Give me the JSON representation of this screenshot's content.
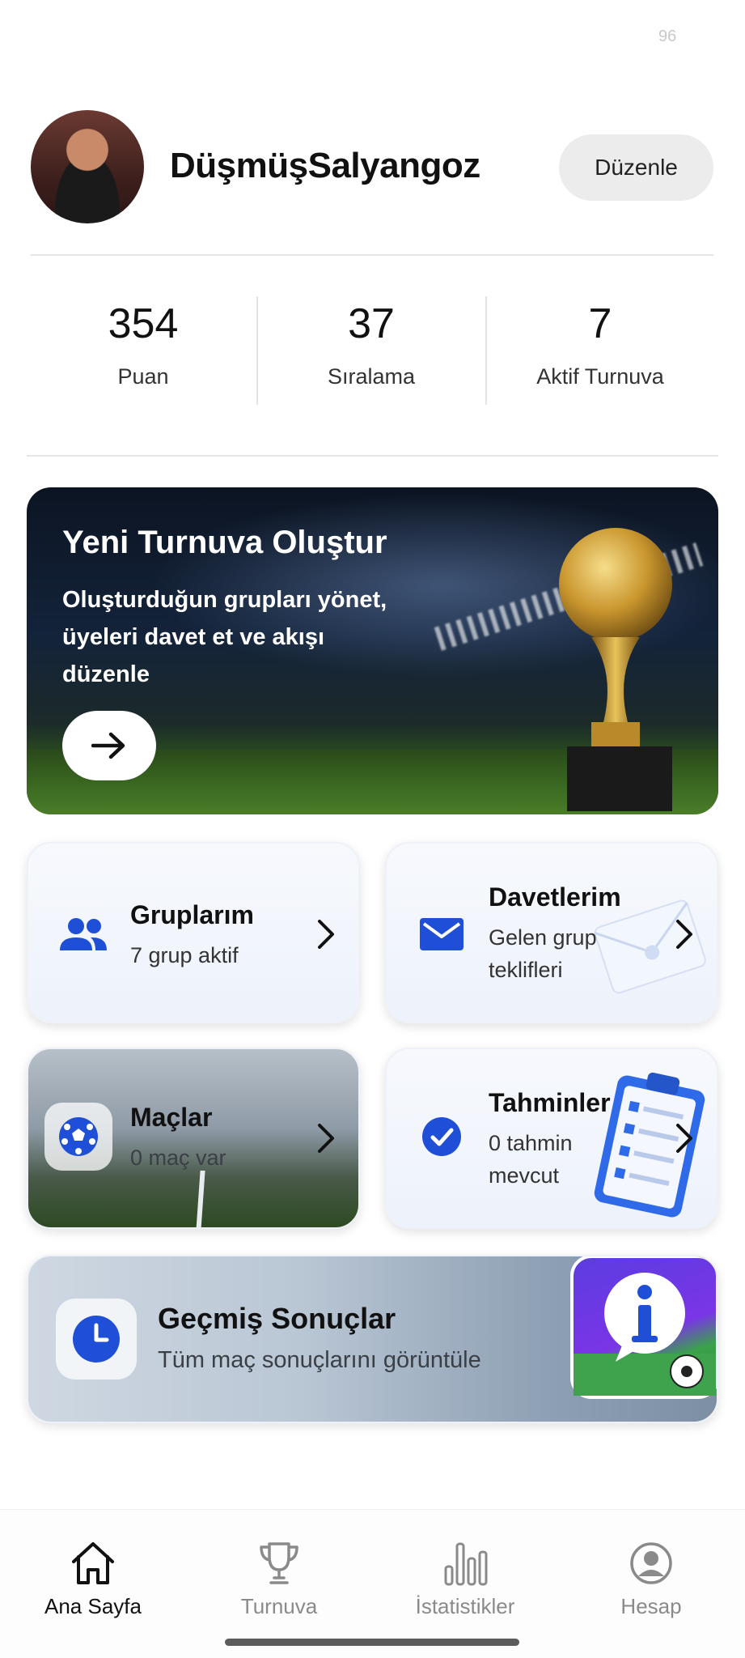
{
  "status": {
    "number": "96"
  },
  "profile": {
    "username": "DüşmüşSalyangoz",
    "edit_label": "Düzenle"
  },
  "stats": [
    {
      "value": "354",
      "label": "Puan"
    },
    {
      "value": "37",
      "label": "Sıralama"
    },
    {
      "value": "7",
      "label": "Aktif Turnuva"
    }
  ],
  "banner": {
    "title": "Yeni Turnuva Oluştur",
    "subtitle": "Oluşturduğun grupları yönet, üyeleri davet et ve akışı düzenle"
  },
  "cards": {
    "groups": {
      "title": "Gruplarım",
      "subtitle": "7 grup aktif"
    },
    "invites": {
      "title": "Davetlerim",
      "subtitle": "Gelen grup teklifleri"
    },
    "matches": {
      "title": "Maçlar",
      "subtitle": "0 maç var"
    },
    "predictions": {
      "title": "Tahminler",
      "subtitle": "0 tahmin mevcut"
    },
    "history": {
      "title": "Geçmiş Sonuçlar",
      "subtitle": "Tüm maç sonuçlarını görüntüle"
    }
  },
  "nav": [
    {
      "label": "Ana Sayfa",
      "icon": "home-icon",
      "active": true
    },
    {
      "label": "Turnuva",
      "icon": "trophy-icon",
      "active": false
    },
    {
      "label": "İstatistikler",
      "icon": "bar-chart-icon",
      "active": false
    },
    {
      "label": "Hesap",
      "icon": "account-icon",
      "active": false
    }
  ],
  "colors": {
    "accent": "#1e4fd6",
    "text": "#111111",
    "muted": "#8a8a8a"
  }
}
